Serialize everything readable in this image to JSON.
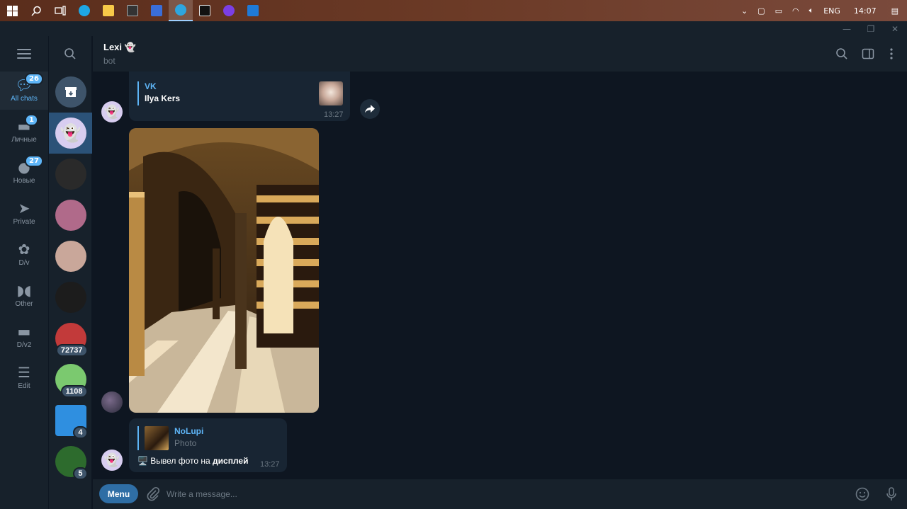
{
  "taskbar": {
    "apps": [
      {
        "icon": "windows-start-icon",
        "color": "#ffffff"
      },
      {
        "icon": "search-icon",
        "color": "#ffffff"
      },
      {
        "icon": "task-view-icon",
        "color": "#ffffff"
      },
      {
        "icon": "edge-icon",
        "color": "#1ea7e4"
      },
      {
        "icon": "file-explorer-icon",
        "color": "#f7c948"
      },
      {
        "icon": "terminal-icon",
        "color": "#333333"
      },
      {
        "icon": "app-icon",
        "color": "#3a6ed8"
      },
      {
        "icon": "telegram-icon",
        "color": "#2ea6df"
      },
      {
        "icon": "pycharm-icon",
        "color": "#111111"
      },
      {
        "icon": "github-icon",
        "color": "#7b3fe4"
      },
      {
        "icon": "photos-icon",
        "color": "#1f7ad8"
      }
    ],
    "lang": "ENG",
    "time": "14:07"
  },
  "folders": [
    {
      "label": "All chats",
      "badge": "26",
      "icon": "chats-icon",
      "active": true
    },
    {
      "label": "Личные",
      "badge": "1",
      "icon": "folder-icon"
    },
    {
      "label": "Новые",
      "badge": "27",
      "icon": "chat-bubble-icon"
    },
    {
      "label": "Private",
      "badge": "",
      "icon": "paper-plane-icon"
    },
    {
      "label": "D/v",
      "badge": "",
      "icon": "flower-icon"
    },
    {
      "label": "Other",
      "badge": "",
      "icon": "mask-icon"
    },
    {
      "label": "D/v2",
      "badge": "",
      "icon": "folder-icon"
    },
    {
      "label": "Edit",
      "badge": "",
      "icon": "sliders-icon"
    }
  ],
  "chats": [
    {
      "name": "archive",
      "badge": "",
      "color": "#3e546a"
    },
    {
      "name": "lexi",
      "badge": "",
      "color": "#d8cdf0"
    },
    {
      "name": "chat-3",
      "badge": "",
      "color": "#2a2a2a"
    },
    {
      "name": "chat-4",
      "badge": "",
      "color": "#b06a8a"
    },
    {
      "name": "chat-5",
      "badge": "",
      "color": "#c9a79a"
    },
    {
      "name": "chat-6",
      "badge": "",
      "color": "#1c1c1c"
    },
    {
      "name": "chat-7",
      "badge": "72737",
      "color": "#c23a3a"
    },
    {
      "name": "chat-8",
      "badge": "1108",
      "color": "#7bc96f"
    },
    {
      "name": "chat-9",
      "badge": "4",
      "color": "#2f8fe0"
    },
    {
      "name": "chat-10",
      "badge": "5",
      "color": "#2d6b2d"
    }
  ],
  "header": {
    "name": "Lexi 👻",
    "status": "bot"
  },
  "messages": {
    "msg1": {
      "reply_name": "VK",
      "reply_text": "Ilya Kers",
      "time": "13:27"
    },
    "msg3": {
      "reply_name": "NoLupi",
      "reply_sub": "Photo",
      "text_plain": "🖥️ Вывел фото на ",
      "text_bold": "дисплей",
      "time": "13:27"
    }
  },
  "composer": {
    "menu": "Menu",
    "placeholder": "Write a message..."
  }
}
